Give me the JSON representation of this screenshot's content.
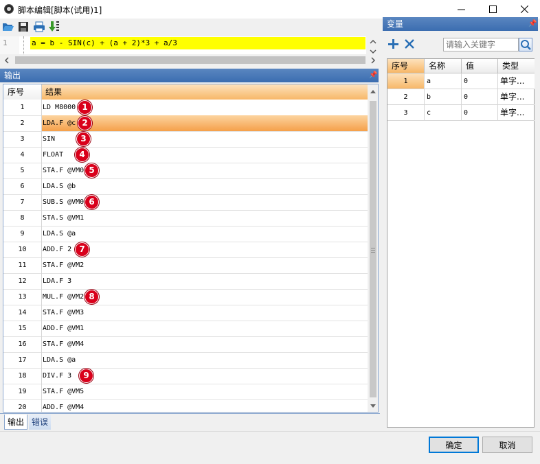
{
  "window": {
    "title": "脚本编辑[脚本(试用)1]"
  },
  "editor": {
    "line_number": "1",
    "code": "a = b - SIN(c) + (a + 2)*3 + a/3"
  },
  "output": {
    "panel_title": "输出",
    "headers": {
      "index": "序号",
      "result": "结果"
    },
    "rows": [
      {
        "index": "1",
        "text": "LD M8000",
        "badge": "1"
      },
      {
        "index": "2",
        "text": "LDA.F @c",
        "badge": "2"
      },
      {
        "index": "3",
        "text": "SIN",
        "badge": "3"
      },
      {
        "index": "4",
        "text": "FLOAT",
        "badge": "4"
      },
      {
        "index": "5",
        "text": "STA.F @VM0",
        "badge": "5"
      },
      {
        "index": "6",
        "text": "LDA.S @b",
        "badge": ""
      },
      {
        "index": "7",
        "text": "SUB.S @VM0",
        "badge": "6"
      },
      {
        "index": "8",
        "text": "STA.S @VM1",
        "badge": ""
      },
      {
        "index": "9",
        "text": "LDA.S @a",
        "badge": ""
      },
      {
        "index": "10",
        "text": "ADD.F 2",
        "badge": "7"
      },
      {
        "index": "11",
        "text": "STA.F @VM2",
        "badge": ""
      },
      {
        "index": "12",
        "text": "LDA.F 3",
        "badge": ""
      },
      {
        "index": "13",
        "text": "MUL.F @VM2",
        "badge": "8"
      },
      {
        "index": "14",
        "text": "STA.F @VM3",
        "badge": ""
      },
      {
        "index": "15",
        "text": "ADD.F @VM1",
        "badge": ""
      },
      {
        "index": "16",
        "text": "STA.F @VM4",
        "badge": ""
      },
      {
        "index": "17",
        "text": "LDA.S @a",
        "badge": ""
      },
      {
        "index": "18",
        "text": "DIV.F 3",
        "badge": "9"
      },
      {
        "index": "19",
        "text": "STA.F @VM5",
        "badge": ""
      },
      {
        "index": "20",
        "text": "ADD.F @VM4",
        "badge": ""
      }
    ],
    "selected_row": "2"
  },
  "tabs": {
    "output": "输出",
    "errors": "错误"
  },
  "variables": {
    "panel_title": "变量",
    "search_placeholder": "请输入关键字",
    "headers": {
      "index": "序号",
      "name": "名称",
      "value": "值",
      "type": "类型"
    },
    "rows": [
      {
        "index": "1",
        "name": "a",
        "value": "0",
        "type": "单字..."
      },
      {
        "index": "2",
        "name": "b",
        "value": "0",
        "type": "单字..."
      },
      {
        "index": "3",
        "name": "c",
        "value": "0",
        "type": "单字..."
      }
    ]
  },
  "buttons": {
    "ok": "确定",
    "cancel": "取消"
  },
  "icons": {
    "open": "folder-open-icon",
    "save": "save-icon",
    "print": "print-icon",
    "compile": "compile-arrow-icon",
    "add": "plus-icon",
    "delete": "close-icon",
    "search": "search-icon",
    "pin": "pin-icon"
  },
  "colors": {
    "accent": "#3b6db0",
    "highlight": "#ffff00",
    "selection": "#f5a04a",
    "badge": "#d9001b"
  }
}
